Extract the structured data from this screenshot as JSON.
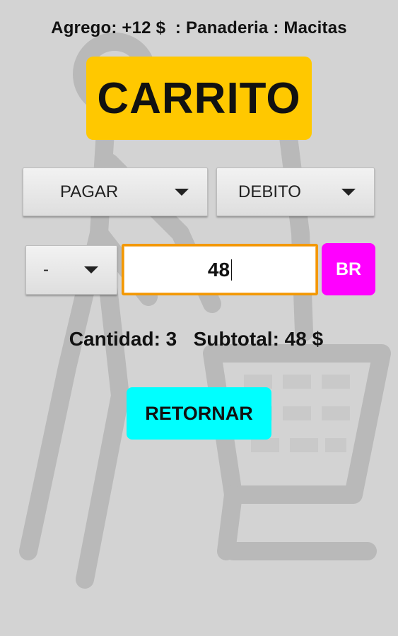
{
  "colors": {
    "background": "#d3d3d3",
    "title_box": "#ffc800",
    "br_button": "#ff00ff",
    "return_button": "#00ffff",
    "input_border": "#f39800"
  },
  "header": {
    "info_line": "Agrego: +12 $  : Panaderia : Macitas"
  },
  "title": "CARRITO",
  "spinners": {
    "payment_action": "PAGAR",
    "payment_method": "DEBITO",
    "option": "-"
  },
  "amount_input": {
    "value": "48"
  },
  "br_button_label": "BR",
  "summary": {
    "text": "Cantidad: 3   Subtotal: 48 $"
  },
  "return_button_label": "RETORNAR",
  "background_art": {
    "icon": "shopping-cart-person-icon"
  }
}
